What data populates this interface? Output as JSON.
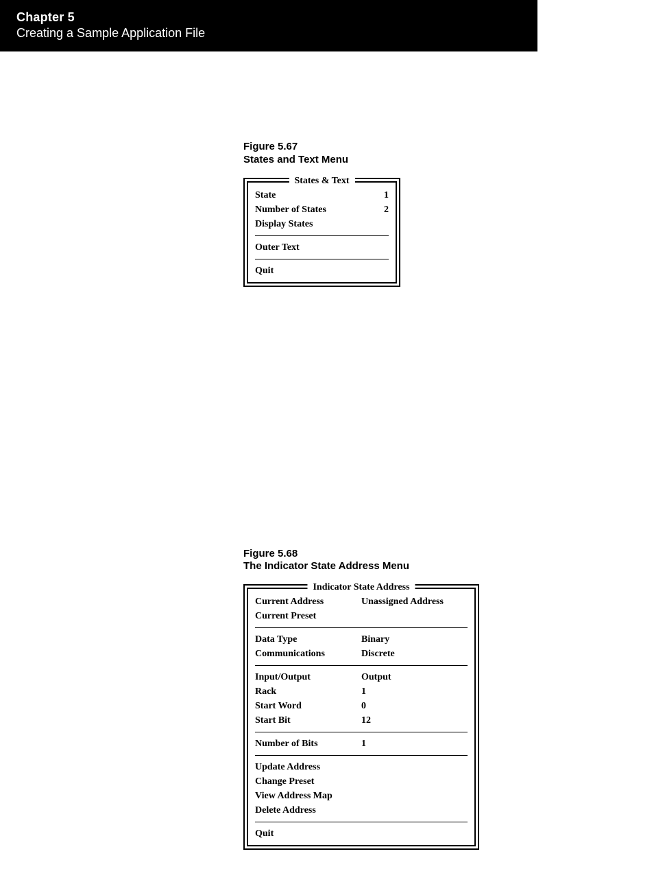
{
  "header": {
    "chapter": "Chapter 5",
    "subtitle": "Creating a Sample Application File"
  },
  "fig567": {
    "caption_l1": "Figure 5.67",
    "caption_l2": "States and Text Menu",
    "box_title": "States & Text",
    "rows": [
      {
        "label": "State",
        "value": "1"
      },
      {
        "label": "Number of States",
        "value": "2"
      },
      {
        "label": "Display States",
        "value": ""
      }
    ],
    "outer_text": "Outer Text",
    "quit": "Quit"
  },
  "fig568": {
    "caption_l1": "Figure 5.68",
    "caption_l2": "The Indicator State Address Menu",
    "box_title": "Indicator State Address",
    "sec1": [
      {
        "label": "Current Address",
        "value": "Unassigned Address"
      },
      {
        "label": "Current Preset",
        "value": ""
      }
    ],
    "sec2": [
      {
        "label": "Data Type",
        "value": "Binary"
      },
      {
        "label": "Communications",
        "value": "Discrete"
      }
    ],
    "sec3": [
      {
        "label": "Input/Output",
        "value": "Output"
      },
      {
        "label": "Rack",
        "value": "1"
      },
      {
        "label": "Start Word",
        "value": "0"
      },
      {
        "label": "Start Bit",
        "value": "12"
      }
    ],
    "sec4": [
      {
        "label": "Number of Bits",
        "value": "1"
      }
    ],
    "sec5": [
      {
        "label": "Update Address",
        "value": ""
      },
      {
        "label": "Change Preset",
        "value": ""
      },
      {
        "label": "View Address Map",
        "value": ""
      },
      {
        "label": "Delete Address",
        "value": ""
      }
    ],
    "quit": "Quit"
  }
}
